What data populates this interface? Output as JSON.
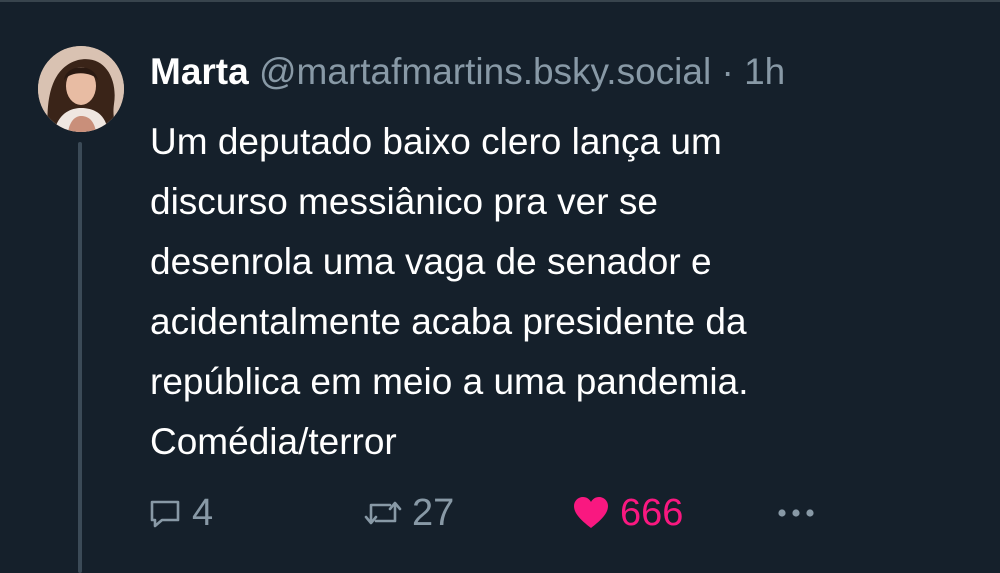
{
  "tweet": {
    "display_name": "Marta",
    "handle": "@martafmartins.bsky.social",
    "separator": "·",
    "time": "1h",
    "lines": [
      "Um deputado baixo clero lança um",
      "discurso messiânico pra ver se",
      "desenrola uma vaga de senador e",
      "acidentalmente acaba presidente da",
      "república em meio a uma pandemia.",
      "Comédia/terror"
    ]
  },
  "actions": {
    "reply_count": "4",
    "retweet_count": "27",
    "like_count": "666"
  },
  "icons": {
    "reply": "comment-icon",
    "retweet": "retweet-icon",
    "like": "heart-icon",
    "more": "more-icon"
  },
  "colors": {
    "background": "#15202b",
    "secondary_text": "#8899a6",
    "like": "#f91880"
  }
}
